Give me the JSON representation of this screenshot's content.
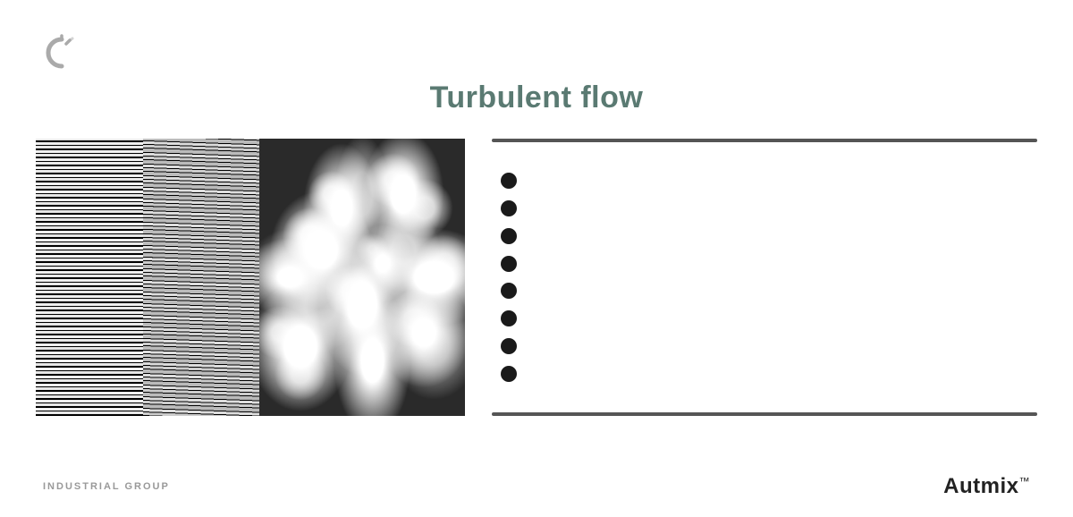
{
  "logo": {
    "alt": "Autmix Logo Icon"
  },
  "title": "Turbulent flow",
  "image": {
    "alt": "Turbulent flow visualization showing transition from laminar to turbulent"
  },
  "bullets": {
    "count": 8,
    "items": [
      "",
      "",
      "",
      "",
      "",
      "",
      "",
      ""
    ]
  },
  "footer": {
    "left": "INDUSTRIAL GROUP",
    "right": "Autmix",
    "trademark": "™"
  }
}
